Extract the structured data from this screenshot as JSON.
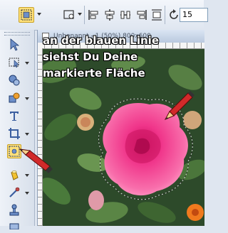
{
  "optionbar": {
    "rotation_value": "15"
  },
  "document": {
    "title": "Unbenannt - 1 (50%) 800x600"
  },
  "caption": {
    "line1": "an der blauen Linie",
    "line2": "siehst Du Deine",
    "line3": "markierte Fläche"
  },
  "colors": {
    "selection_outline": "#222222",
    "rose": "#f0358a",
    "highlight": "#ffe07a",
    "pencil": "#d12a2a"
  }
}
